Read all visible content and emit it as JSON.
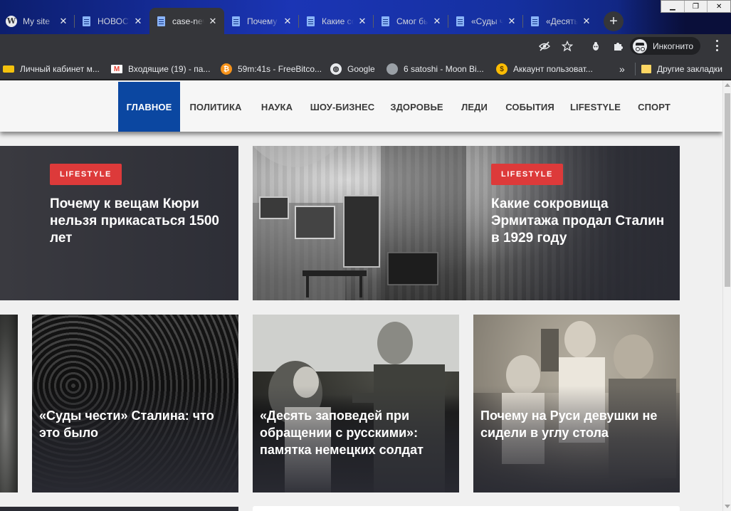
{
  "browser": {
    "tabs": [
      {
        "title": "My site",
        "icon": "wordpress-icon",
        "active": false
      },
      {
        "title": "НОВОСТИ",
        "icon": "document-icon",
        "active": false
      },
      {
        "title": "case-news",
        "icon": "document-icon",
        "active": true
      },
      {
        "title": "Почему к вещам",
        "icon": "document-icon",
        "active": false
      },
      {
        "title": "Какие сокровища",
        "icon": "document-icon",
        "active": false
      },
      {
        "title": "Смог бы",
        "icon": "document-icon",
        "active": false
      },
      {
        "title": "«Суды чести»",
        "icon": "document-icon",
        "active": false
      },
      {
        "title": "«Десять заповедей",
        "icon": "document-icon",
        "active": false
      }
    ],
    "new_tab_label": "+",
    "incognito_label": "Инкогнито",
    "bookmarks": [
      {
        "label": "Личный кабинет м...",
        "icon": "card-icon",
        "color": "#f4c20d"
      },
      {
        "label": "Входящие (19) - па...",
        "icon": "gmail-icon",
        "color": "#ea4335"
      },
      {
        "label": "59m:41s - FreeBitco...",
        "icon": "bitcoin-icon",
        "color": "#f7931a"
      },
      {
        "label": "Google",
        "icon": "globe-icon",
        "color": "#e8eaed"
      },
      {
        "label": "6 satoshi - Moon Bi...",
        "icon": "moon-icon",
        "color": "#9aa0a6"
      },
      {
        "label": "Аккаунт пользоват...",
        "icon": "dollar-icon",
        "color": "#fbbc04"
      }
    ],
    "bookmarks_overflow": "»",
    "other_bookmarks_label": "Другие закладки",
    "colors": {
      "tab_bar": "#1b35b5",
      "toolbar": "#35363a"
    }
  },
  "site": {
    "nav": [
      {
        "label": "Главное",
        "active": true
      },
      {
        "label": "Политика",
        "active": false
      },
      {
        "label": "Наука",
        "active": false
      },
      {
        "label": "Шоу-бизнес",
        "active": false
      },
      {
        "label": "Здоровье",
        "active": false
      },
      {
        "label": "Леди",
        "active": false
      },
      {
        "label": "События",
        "active": false
      },
      {
        "label": "Lifestyle",
        "active": false
      },
      {
        "label": "Спорт",
        "active": false
      }
    ],
    "featured": [
      {
        "badge": "LIFESTYLE",
        "headline": "Почему к вещам Кюри нельзя прикасаться 1500 лет"
      },
      {
        "badge": "LIFESTYLE",
        "headline": "Какие сокровища Эрмитажа продал Сталин в 1929 году"
      }
    ],
    "articles": [
      {
        "headline": "«Суды чести» Сталина: что это было"
      },
      {
        "headline": "«Десять заповедей при обращении с русскими»: памятка немецких солдат"
      },
      {
        "headline": "Почему на Руси девушки не сидели в углу стола"
      }
    ],
    "colors": {
      "accent": "#0b47a1",
      "badge": "#dd3a3a",
      "card_bg": "#2a2b33"
    }
  }
}
